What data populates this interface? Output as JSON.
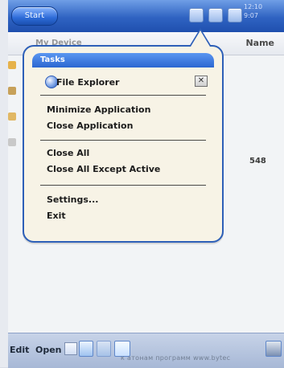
{
  "topbar": {
    "start_label": "Start",
    "clock_line1": "12:10",
    "clock_line2": "9:07"
  },
  "header": {
    "device_label": "My Device",
    "name_label": "Name"
  },
  "list": {
    "size_value": "548"
  },
  "tasks": {
    "title": "Tasks",
    "active_app_label": "File Explorer",
    "close_active_glyph": "✕",
    "items": [
      {
        "label": "Minimize Application"
      },
      {
        "label": "Close Application"
      },
      {
        "label": "Close All"
      },
      {
        "label": "Close All Except Active"
      },
      {
        "label": "Settings..."
      },
      {
        "label": "Exit"
      }
    ]
  },
  "bottombar": {
    "edit_label": "Edit",
    "open_label": "Open",
    "watermark_text": "к атонам программ www.bytec"
  },
  "colors": {
    "title_blue": "#2b67d1",
    "popup_bg": "#f7f3e6",
    "border_blue": "#2d5fb8"
  },
  "icons": {
    "start": "start-button-icon",
    "file_explorer": "file-explorer-icon",
    "close": "close-icon",
    "taskbar_1": "network-icon",
    "taskbar_2": "volume-icon",
    "taskbar_3": "connection-icon",
    "taskbar_4": "keyboard-icon"
  }
}
